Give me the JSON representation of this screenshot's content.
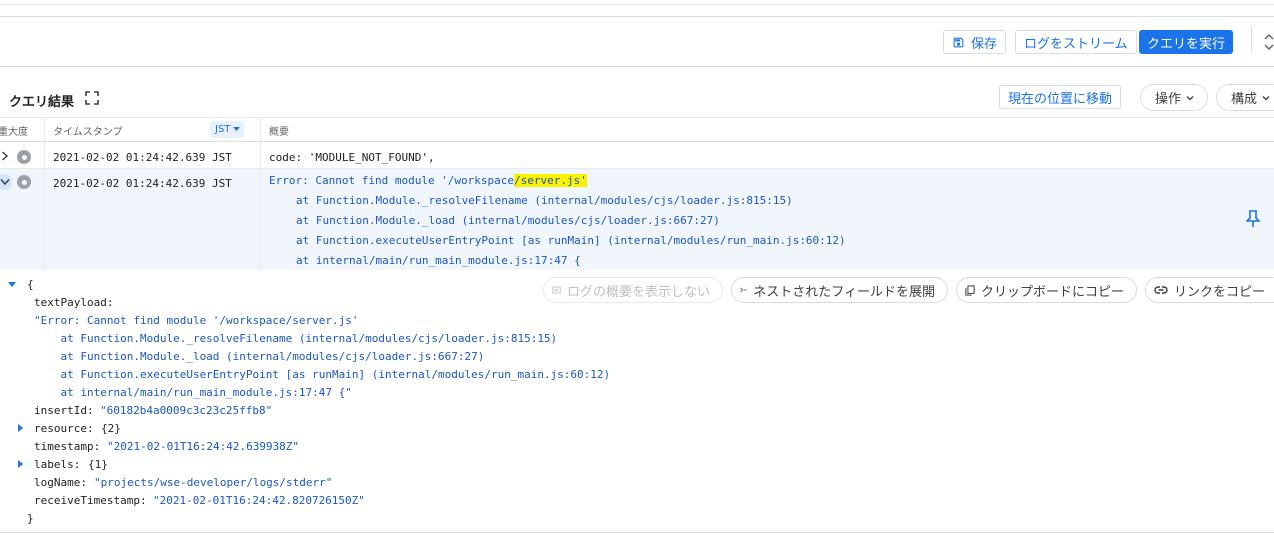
{
  "toolbar": {
    "save_label": "保存",
    "stream_label": "ログをストリーム",
    "run_label": "クエリを実行"
  },
  "results": {
    "title": "クエリ結果",
    "jump_now_label": "現在の位置に移動",
    "actions_label": "操作",
    "configure_label": "構成"
  },
  "columns": {
    "severity": "重大度",
    "timestamp": "タイムスタンプ",
    "timezone": "JST",
    "summary": "概要"
  },
  "rows": [
    {
      "timestamp": "2021-02-02 01:24:42.639 JST",
      "summary": "code: 'MODULE_NOT_FOUND',"
    },
    {
      "timestamp": "2021-02-02 01:24:42.639 JST",
      "summary_prefix": "Error: Cannot find module '/workspace",
      "summary_highlight": "/server.js'",
      "summary_lines": [
        "at Function.Module._resolveFilename (internal/modules/cjs/loader.js:815:15)",
        "at Function.Module._load (internal/modules/cjs/loader.js:667:27)",
        "at Function.executeUserEntryPoint [as runMain] (internal/modules/run_main.js:60:12)",
        "at internal/main/run_main_module.js:17:47 {"
      ]
    }
  ],
  "detail_actions": {
    "hide_summary": "ログの概要を表示しない",
    "expand_nested": "ネストされたフィールドを展開",
    "copy_clipboard": "クリップボードにコピー",
    "copy_link": "リンクをコピー"
  },
  "json": {
    "open_brace": "{",
    "close_brace": "}",
    "text_payload_key": "textPayload:",
    "text_payload_lines": [
      "\"Error: Cannot find module '/workspace/server.js'",
      "    at Function.Module._resolveFilename (internal/modules/cjs/loader.js:815:15)",
      "    at Function.Module._load (internal/modules/cjs/loader.js:667:27)",
      "    at Function.executeUserEntryPoint [as runMain] (internal/modules/run_main.js:60:12)",
      "    at internal/main/run_main_module.js:17:47 {\""
    ],
    "insert_id_key": "insertId:",
    "insert_id_value": "\"60182b4a0009c3c23c25ffb8\"",
    "resource_key": "resource:",
    "resource_value": "{2}",
    "timestamp_key": "timestamp:",
    "timestamp_value": "\"2021-02-01T16:24:42.639938Z\"",
    "labels_key": "labels:",
    "labels_value": "{1}",
    "log_name_key": "logName:",
    "log_name_value": "\"projects/wse-developer/logs/stderr\"",
    "receive_timestamp_key": "receiveTimestamp:",
    "receive_timestamp_value": "\"2021-02-01T16:24:42.820726150Z\""
  },
  "colors": {
    "accent": "#1a73e8",
    "highlight": "#fbf200",
    "selected_row": "#f1f6fd"
  }
}
